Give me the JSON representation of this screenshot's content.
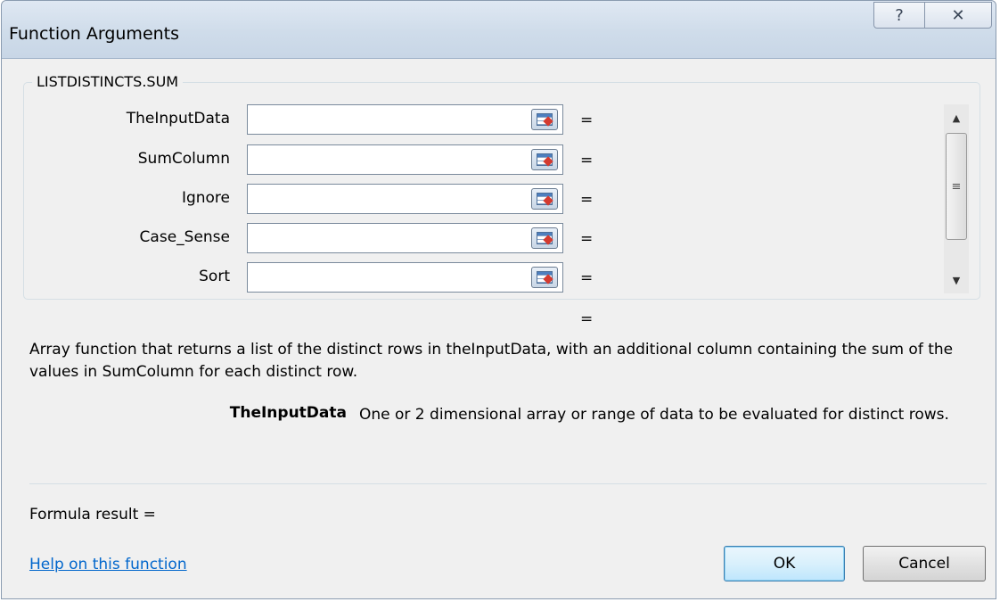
{
  "window": {
    "title": "Function Arguments",
    "help_glyph": "?",
    "close_glyph": "✕"
  },
  "function_group": {
    "name": "LISTDISTINCTS.SUM"
  },
  "arguments": [
    {
      "label": "TheInputData",
      "value": "",
      "equals": "="
    },
    {
      "label": "SumColumn",
      "value": "",
      "equals": "="
    },
    {
      "label": "Ignore",
      "value": "",
      "equals": "="
    },
    {
      "label": "Case_Sense",
      "value": "",
      "equals": "="
    },
    {
      "label": "Sort",
      "value": "",
      "equals": "="
    }
  ],
  "scrollbar": {
    "up_glyph": "▲",
    "down_glyph": "▼",
    "grip_glyph": "≡"
  },
  "function_result_equals": "=",
  "function_description": "Array function that returns a list of the distinct rows in theInputData, with an additional column containing the sum of the values in SumColumn for each distinct row.",
  "argument_help": {
    "name": "TheInputData",
    "description": "One or 2 dimensional array or range of data to be evaluated for distinct rows."
  },
  "formula_result_label": "Formula result =",
  "help_link": "Help on this function",
  "buttons": {
    "ok": "OK",
    "cancel": "Cancel"
  },
  "colors": {
    "link": "#0066cc",
    "ok_border": "#3c7fb1"
  }
}
